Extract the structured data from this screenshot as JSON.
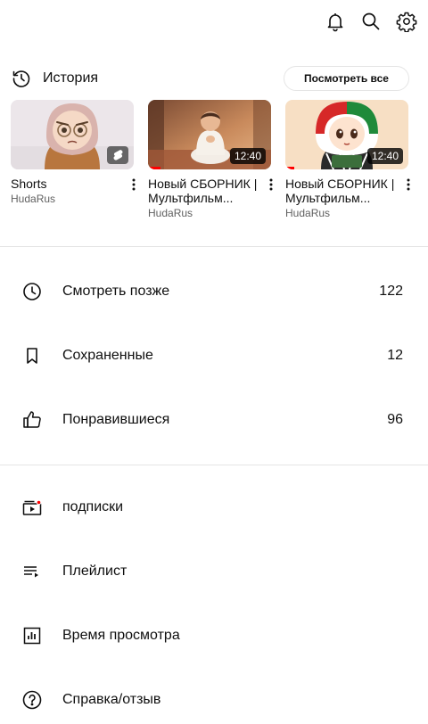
{
  "header": {
    "icons": [
      "bell-icon",
      "search-icon",
      "gear-icon"
    ]
  },
  "history": {
    "title": "История",
    "view_all_label": "Посмотреть все",
    "items": [
      {
        "title": "Shorts",
        "channel": "HudaRus",
        "duration": "",
        "type": "shorts"
      },
      {
        "title": "Новый СБОРНИК | Мультфильм...",
        "channel": "HudaRus",
        "duration": "12:40",
        "type": "video"
      },
      {
        "title": "Новый СБОРНИК | Мультфильм...",
        "channel": "HudaRus",
        "duration": "12:40",
        "type": "video"
      }
    ]
  },
  "library": {
    "items": [
      {
        "label": "Смотреть позже",
        "count": "122",
        "icon": "clock-icon"
      },
      {
        "label": "Сохраненные",
        "count": "12",
        "icon": "bookmark-icon"
      },
      {
        "label": "Понравившиеся",
        "count": "96",
        "icon": "thumbs-up-icon"
      }
    ]
  },
  "more": {
    "items": [
      {
        "label": "подписки",
        "icon": "subscriptions-icon"
      },
      {
        "label": "Плейлист",
        "icon": "playlist-icon"
      },
      {
        "label": "Время просмотра",
        "icon": "watch-time-icon"
      },
      {
        "label": "Справка/отзыв",
        "icon": "help-icon"
      }
    ]
  },
  "colors": {
    "accent": "#ff0000",
    "text": "#0f0f0f",
    "secondary_text": "#606060",
    "divider": "#e5e5e5"
  }
}
